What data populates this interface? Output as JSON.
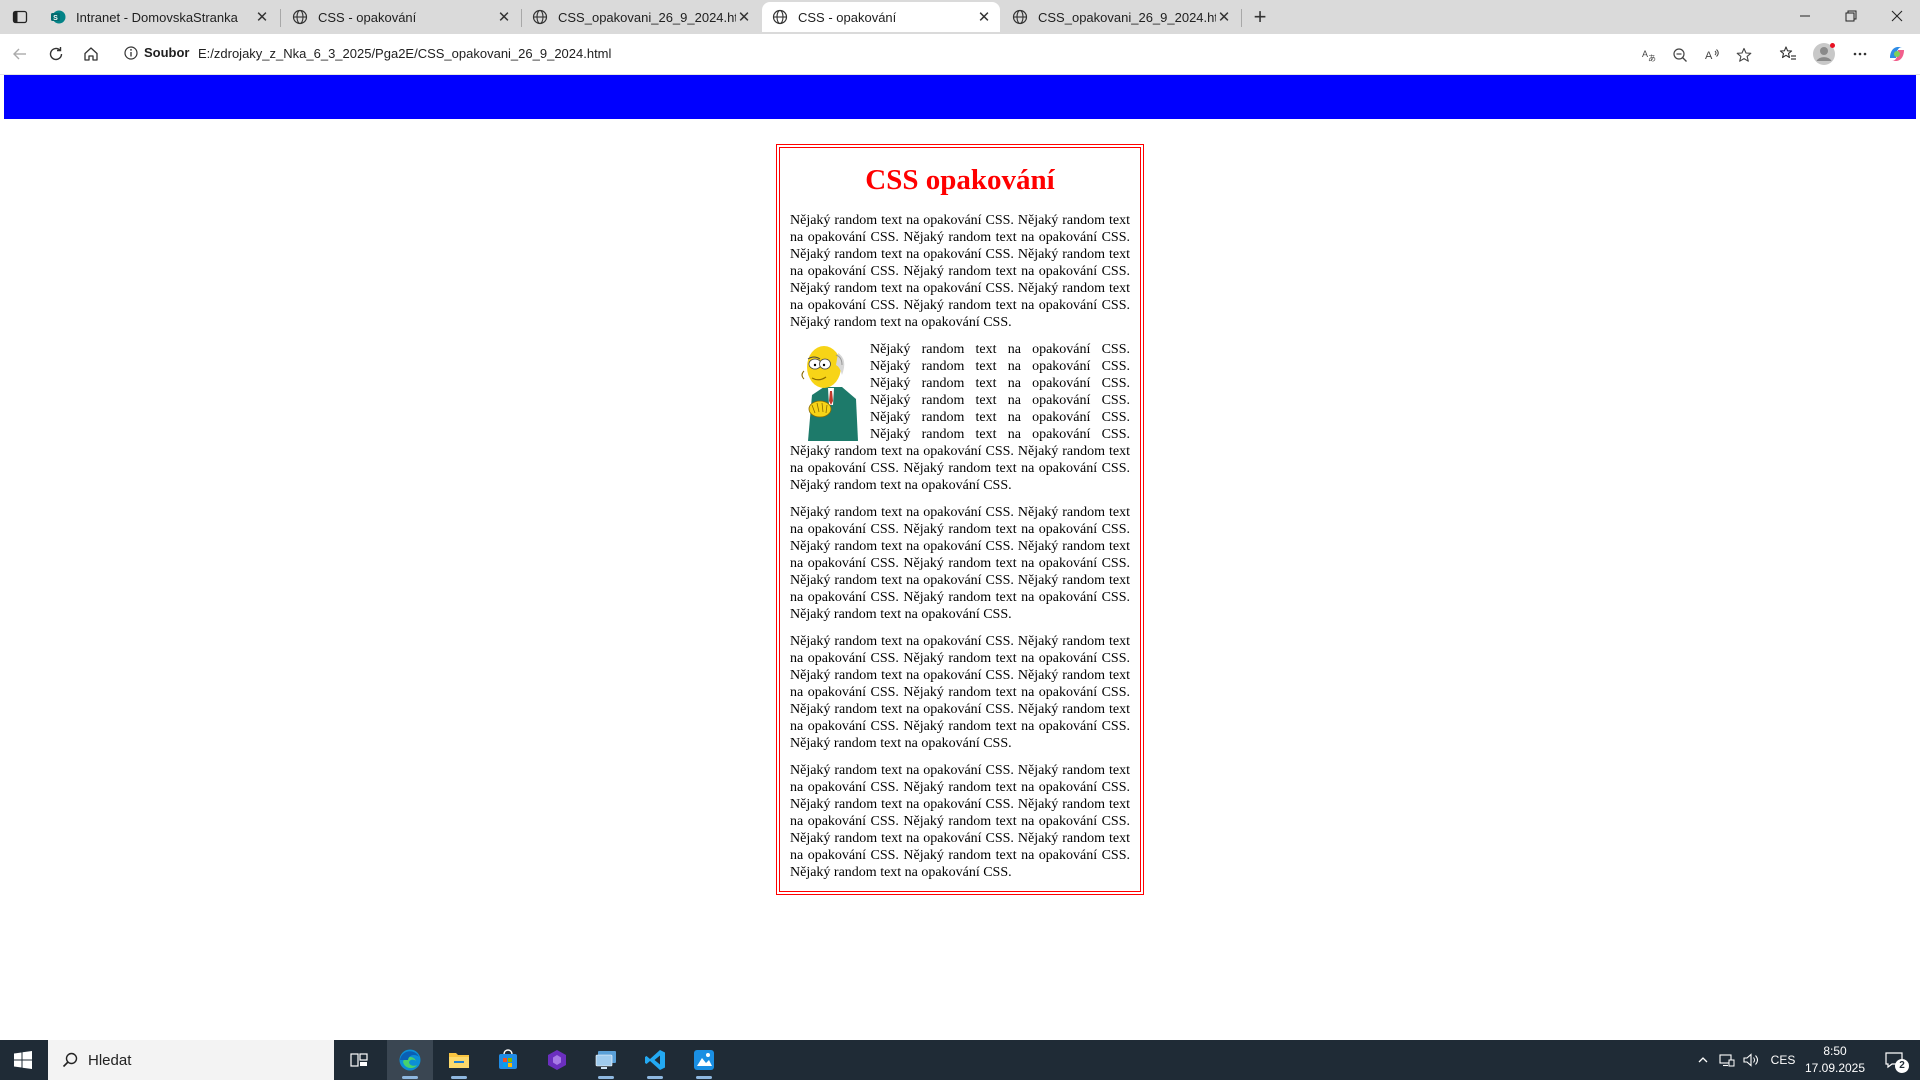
{
  "browser": {
    "tabs": [
      {
        "title": "Intranet - DomovskaStranka",
        "favicon": "sharepoint-icon",
        "active": false
      },
      {
        "title": "CSS - opakování",
        "favicon": "globe-icon",
        "active": false
      },
      {
        "title": "CSS_opakovani_26_9_2024.html",
        "favicon": "globe-icon",
        "active": false
      },
      {
        "title": "CSS - opakování",
        "favicon": "globe-icon",
        "active": true
      },
      {
        "title": "CSS_opakovani_26_9_2024.html",
        "favicon": "globe-icon",
        "active": false
      }
    ],
    "site_info_label": "Soubor",
    "url": "E:/zdrojaky_z_Nka_6_3_2025/Pga2E/CSS_opakovani_26_9_2024.html"
  },
  "page": {
    "header_color": "#0000ff",
    "accent_color": "#ff0000",
    "heading": "CSS opakování",
    "paragraphs": [
      "Nějaký random text na opakování CSS. Nějaký random text na opakování CSS. Nějaký random text na opakování CSS. Nějaký random text na opakování CSS. Nějaký random text na opakování CSS. Nějaký random text na opakování CSS. Nějaký random text na opakování CSS. Nějaký random text na opakování CSS. Nějaký random text na opakování CSS. Nějaký random text na opakování CSS.",
      "Nějaký random text na opakování CSS. Nějaký random text na opakování CSS. Nějaký random text na opakování CSS. Nějaký random text na opakování CSS. Nějaký random text na opakování CSS. Nějaký random text na opakování CSS. Nějaký random text na opakování CSS. Nějaký random text na opakování CSS. Nějaký random text na opakování CSS. Nějaký random text na opakování CSS.",
      "Nějaký random text na opakování CSS. Nějaký random text na opakování CSS. Nějaký random text na opakování CSS. Nějaký random text na opakování CSS. Nějaký random text na opakování CSS. Nějaký random text na opakování CSS. Nějaký random text na opakování CSS. Nějaký random text na opakování CSS. Nějaký random text na opakování CSS. Nějaký random text na opakování CSS.",
      "Nějaký random text na opakování CSS. Nějaký random text na opakování CSS. Nějaký random text na opakování CSS. Nějaký random text na opakování CSS. Nějaký random text na opakování CSS. Nějaký random text na opakování CSS. Nějaký random text na opakování CSS. Nějaký random text na opakování CSS. Nějaký random text na opakování CSS. Nějaký random text na opakování CSS.",
      "Nějaký random text na opakování CSS. Nějaký random text na opakování CSS. Nějaký random text na opakování CSS. Nějaký random text na opakování CSS. Nějaký random text na opakování CSS. Nějaký random text na opakování CSS. Nějaký random text na opakování CSS. Nějaký random text na opakování CSS. Nějaký random text na opakování CSS. Nějaký random text na opakování CSS."
    ],
    "image_icon": "cartoon-character-icon"
  },
  "taskbar": {
    "search_placeholder": "Hledat",
    "apps": [
      "task-view-icon",
      "edge-icon",
      "file-explorer-icon",
      "store-icon",
      "visual-studio-icon",
      "remote-desktop-icon",
      "vscode-icon",
      "paint-icon"
    ],
    "language": "CES",
    "time": "8:50",
    "date": "17.09.2025",
    "notification_count": "2"
  }
}
